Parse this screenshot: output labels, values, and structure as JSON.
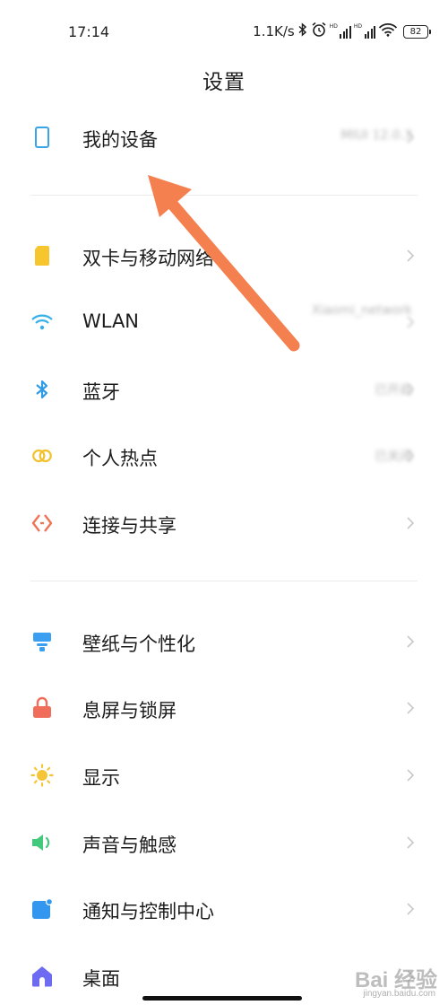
{
  "status_bar": {
    "time": "17:14",
    "net_speed": "1.1K/s",
    "battery": "82"
  },
  "header": {
    "title": "设置"
  },
  "groups": [
    {
      "items": [
        {
          "name": "my-device",
          "label": "我的设备",
          "value": "MIUI 12.0.3",
          "icon": "phone-outline-icon"
        }
      ]
    },
    {
      "items": [
        {
          "name": "dual-sim",
          "label": "双卡与移动网络",
          "icon": "sim-card-icon"
        },
        {
          "name": "wlan",
          "label": "WLAN",
          "value": "Xiaomi_network",
          "icon": "wifi-icon"
        },
        {
          "name": "bluetooth",
          "label": "蓝牙",
          "value": "已开启",
          "icon": "bluetooth-icon"
        },
        {
          "name": "hotspot",
          "label": "个人热点",
          "value": "已关闭",
          "icon": "hotspot-icon"
        },
        {
          "name": "connection-sharing",
          "label": "连接与共享",
          "icon": "share-icon"
        }
      ]
    },
    {
      "items": [
        {
          "name": "wallpaper",
          "label": "壁纸与个性化",
          "icon": "wallpaper-icon"
        },
        {
          "name": "lock-screen",
          "label": "息屏与锁屏",
          "icon": "lock-icon"
        },
        {
          "name": "display",
          "label": "显示",
          "icon": "sun-icon"
        },
        {
          "name": "sound",
          "label": "声音与触感",
          "icon": "speaker-icon"
        },
        {
          "name": "notifications",
          "label": "通知与控制中心",
          "icon": "notification-icon"
        },
        {
          "name": "home-screen",
          "label": "桌面",
          "icon": "home-icon"
        }
      ]
    }
  ],
  "watermark": {
    "main": "Bai 经验",
    "sub": "jingyan.baidu.com"
  },
  "colors": {
    "annotation_arrow": "#f47f4f",
    "sim": "#f7c62f",
    "wifi": "#35b0e8",
    "bluetooth": "#2f9be6",
    "hotspot": "#f2c12e",
    "share": "#ef7457",
    "wallpaper": "#3a9ff0",
    "lock": "#f06d5b",
    "sun": "#f6c437",
    "speaker": "#43c97b",
    "notification": "#3397f0",
    "home": "#6c6bf2"
  }
}
